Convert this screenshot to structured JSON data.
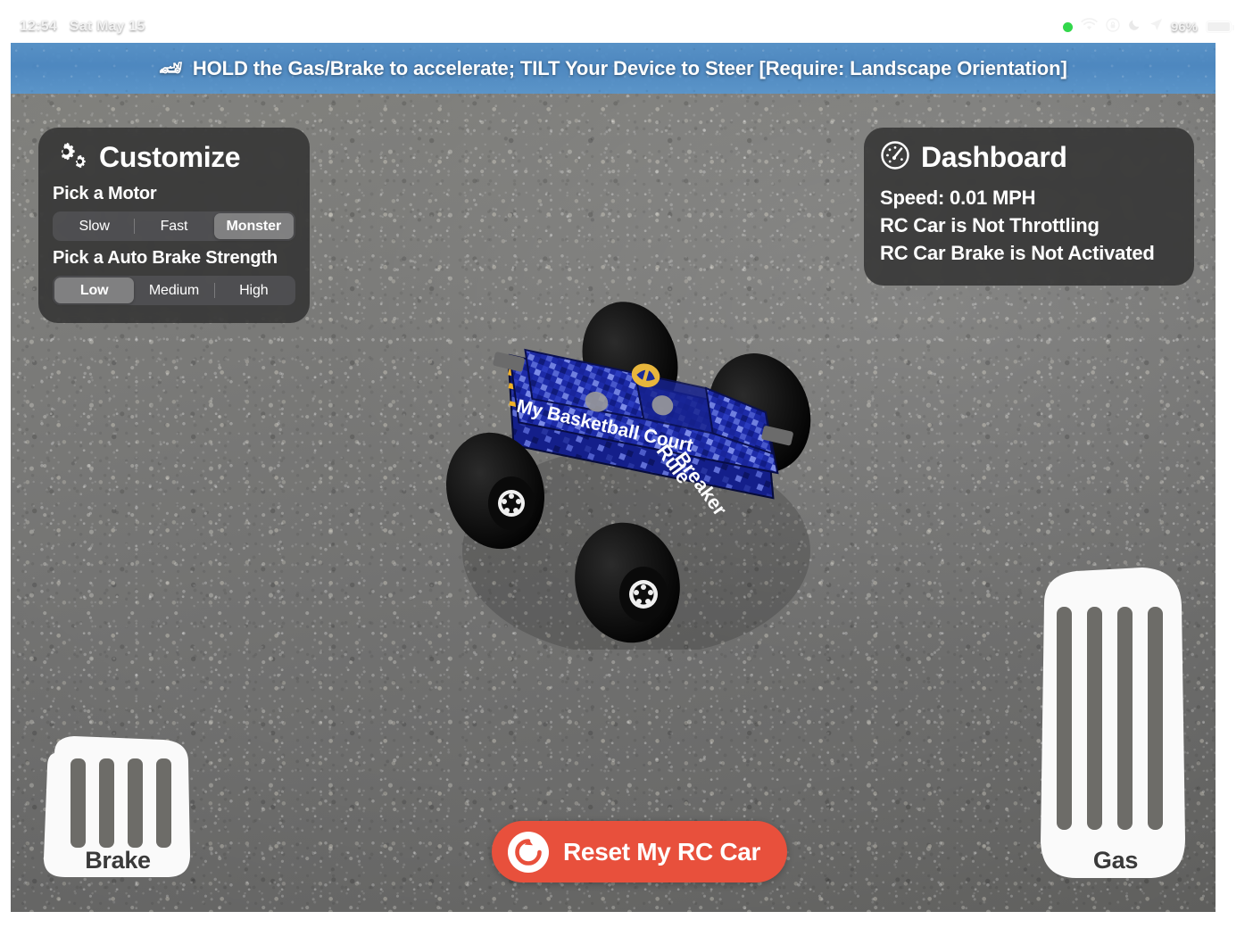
{
  "status_bar": {
    "time": "12:54",
    "date": "Sat May 15",
    "battery_percent": "96%",
    "icons": [
      "green-recording-dot",
      "wifi-icon",
      "rotation-lock-icon",
      "do-not-disturb-moon-icon",
      "location-arrow-icon",
      "battery-icon"
    ]
  },
  "banner": {
    "emoji": "🏎",
    "text": "HOLD the Gas/Brake to accelerate; TILT Your Device to Steer [Require: Landscape Orientation]",
    "background_color": "#4f8cc6"
  },
  "customize": {
    "title": "Customize",
    "icon": "gears-icon",
    "motor": {
      "label": "Pick a Motor",
      "options": [
        "Slow",
        "Fast",
        "Monster"
      ],
      "selected": "Monster",
      "selected_index": 2
    },
    "auto_brake": {
      "label": "Pick a Auto Brake Strength",
      "options": [
        "Low",
        "Medium",
        "High"
      ],
      "selected": "Low",
      "selected_index": 0
    }
  },
  "dashboard": {
    "title": "Dashboard",
    "icon": "speedometer-icon",
    "speed_line": "Speed: 0.01 MPH",
    "throttle_line": "RC Car is Not Throttling",
    "brake_line": "RC Car Brake is Not Activated"
  },
  "controls": {
    "brake_pedal_label": "Brake",
    "gas_pedal_label": "Gas",
    "reset_button_label": "Reset My RC Car",
    "reset_icon": "refresh-circle-icon",
    "reset_color": "#e8503c"
  },
  "car": {
    "name": "rc-monster-truck",
    "body_text_left": "My Basketball Court",
    "body_text_right": "Rule Breaker",
    "body_color": "#1f2fae",
    "stripe_color": "#f0b128"
  }
}
